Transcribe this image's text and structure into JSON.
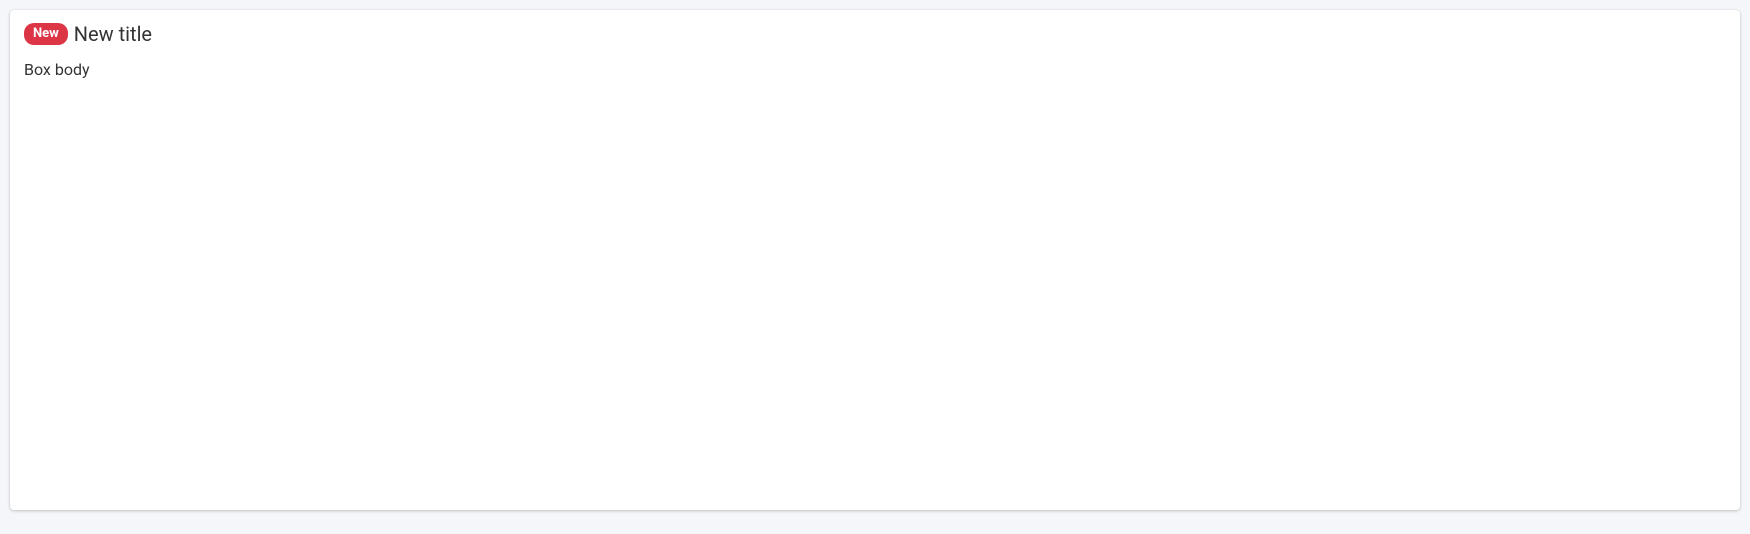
{
  "box": {
    "badge": "New",
    "title": "New title",
    "body": "Box body"
  },
  "colors": {
    "badge_bg": "#dc3545",
    "badge_fg": "#ffffff",
    "page_bg": "#f4f6f9",
    "box_bg": "#ffffff",
    "text": "#333333"
  }
}
